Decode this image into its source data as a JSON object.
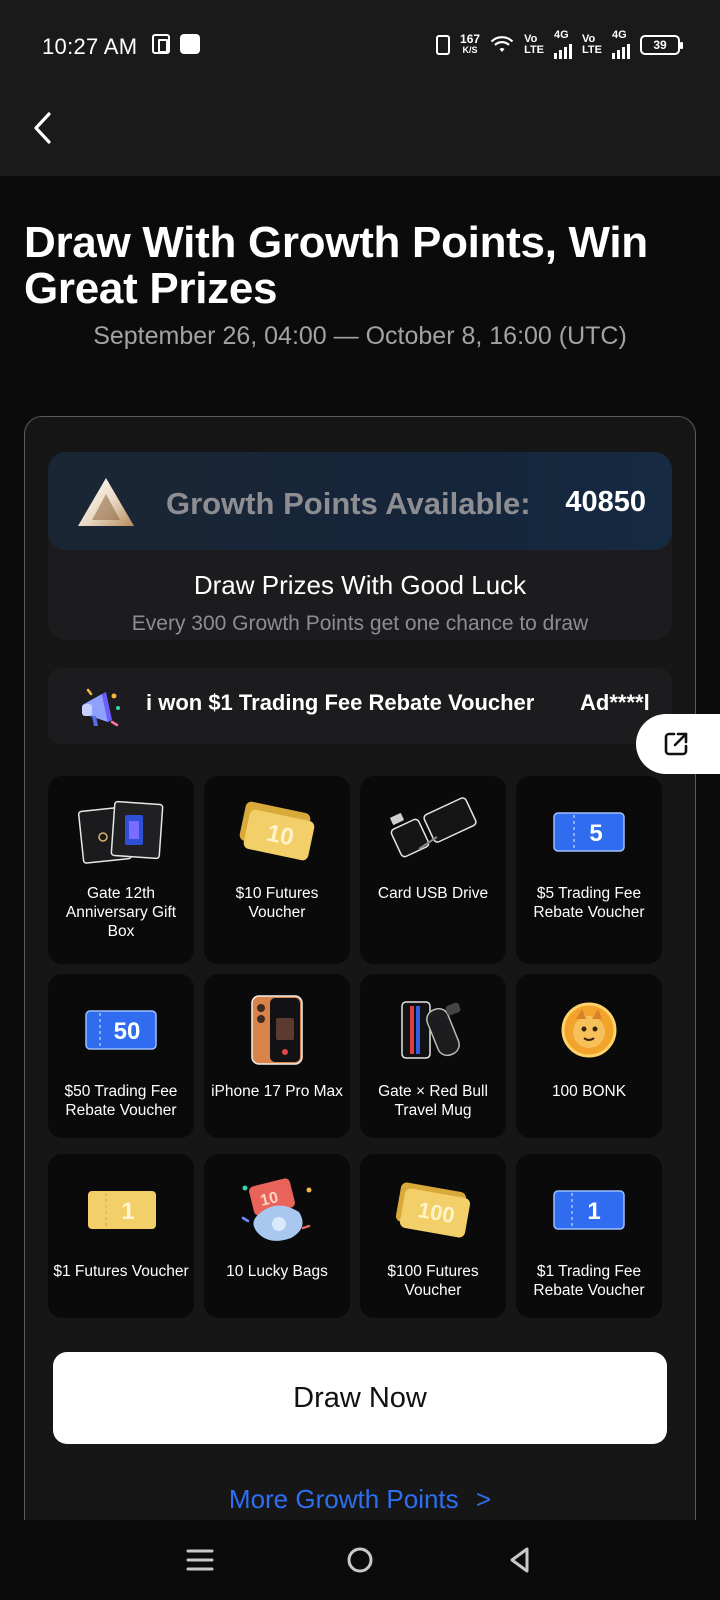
{
  "status": {
    "time": "10:27 AM",
    "speed_value": "167",
    "speed_unit": "K/S",
    "lte1": [
      "Vo",
      "LTE"
    ],
    "net1": "4G",
    "lte2": [
      "Vo",
      "LTE"
    ],
    "net2": "4G",
    "battery": "39"
  },
  "header": {
    "title": "Draw With Growth Points, Win Great Prizes",
    "date_range": "September 26, 04:00 — October 8, 16:00 (UTC)"
  },
  "points": {
    "label": "Growth Points Available:",
    "value": "40850",
    "draw_title": "Draw Prizes With Good Luck",
    "draw_subtitle": "Every 300 Growth Points get one chance to draw"
  },
  "ticker": {
    "message": "i won $1 Trading Fee Rebate Voucher",
    "user": "Ad****l"
  },
  "prizes": [
    {
      "label": "Gate 12th Anniversary Gift Box",
      "icon": "gift-box"
    },
    {
      "label": "$10 Futures Voucher",
      "icon": "gold-voucher",
      "badge": "10"
    },
    {
      "label": "Card USB Drive",
      "icon": "usb-card"
    },
    {
      "label": "$5 Trading Fee Rebate Voucher",
      "icon": "blue-voucher",
      "badge": "5"
    },
    {
      "label": "$50 Trading Fee Rebate Voucher",
      "icon": "blue-voucher",
      "badge": "50"
    },
    {
      "label": "iPhone 17 Pro Max",
      "icon": "phone"
    },
    {
      "label": "Gate × Red Bull Travel Mug",
      "icon": "mug"
    },
    {
      "label": "100 BONK",
      "icon": "bonk-coin"
    },
    {
      "label": "$1 Futures Voucher",
      "icon": "gold-voucher",
      "badge": "1"
    },
    {
      "label": "10 Lucky Bags",
      "icon": "lucky-bag",
      "badge": "10"
    },
    {
      "label": "$100 Futures Voucher",
      "icon": "gold-voucher",
      "badge": "100"
    },
    {
      "label": "$1 Trading Fee Rebate Voucher",
      "icon": "blue-voucher",
      "badge": "1"
    }
  ],
  "actions": {
    "draw_now": "Draw Now",
    "more_points": "More Growth Points",
    "more_chevron": ">"
  },
  "colors": {
    "accent_link": "#2e6ef0",
    "background": "#0b0b0c",
    "card": "#161617"
  }
}
